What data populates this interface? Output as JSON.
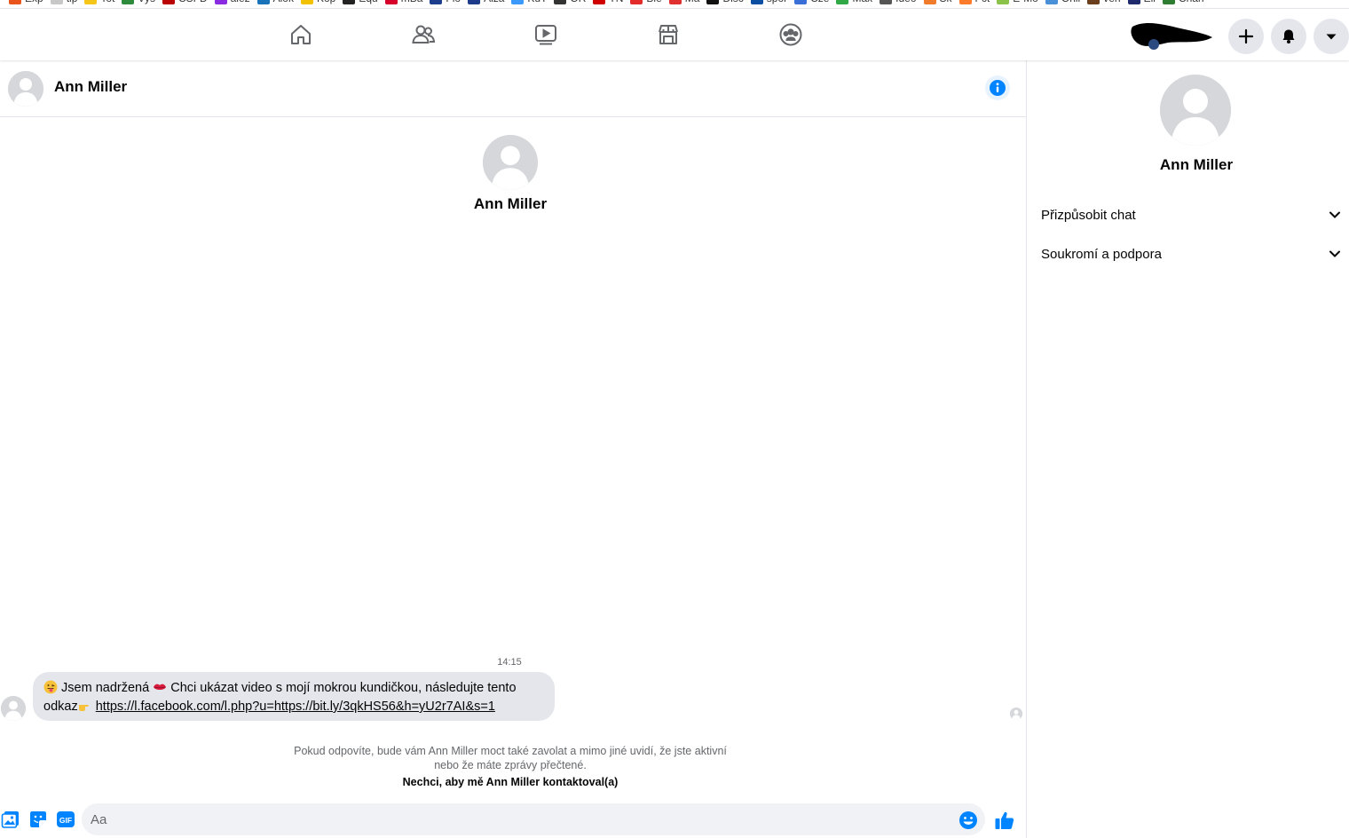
{
  "bookmarks": [
    {
      "label": "Exp",
      "color": "#e8541c"
    },
    {
      "label": "tip",
      "color": "#c8c8c8"
    },
    {
      "label": "Tot",
      "color": "#f5c518"
    },
    {
      "label": "Vys",
      "color": "#2e8b3e"
    },
    {
      "label": "ČSFD",
      "color": "#ba0305"
    },
    {
      "label": "alez",
      "color": "#8a2be2"
    },
    {
      "label": "Alok",
      "color": "#1a73b8"
    },
    {
      "label": "Kop",
      "color": "#f2c100"
    },
    {
      "label": "Equ",
      "color": "#222222"
    },
    {
      "label": "mBa",
      "color": "#d6002a"
    },
    {
      "label": "Flo",
      "color": "#1d3e8c"
    },
    {
      "label": "Alza",
      "color": "#1e3b8a"
    },
    {
      "label": "KuT",
      "color": "#3b99fc"
    },
    {
      "label": "OR",
      "color": "#333333"
    },
    {
      "label": "TN",
      "color": "#d00000"
    },
    {
      "label": "Ble",
      "color": "#e32b2b"
    },
    {
      "label": "Ma",
      "color": "#e03030"
    },
    {
      "label": "Disc",
      "color": "#111111"
    },
    {
      "label": "spor",
      "color": "#0b4ea2"
    },
    {
      "label": "Cze",
      "color": "#3a6fd8"
    },
    {
      "label": "Max",
      "color": "#2fa845"
    },
    {
      "label": "Ideo",
      "color": "#555555"
    },
    {
      "label": "Sk",
      "color": "#f07b2b"
    },
    {
      "label": "Fct",
      "color": "#ff7a2b"
    },
    {
      "label": "E-Mo",
      "color": "#8bc34a"
    },
    {
      "label": "Onli",
      "color": "#4a90d9"
    },
    {
      "label": "ven",
      "color": "#6b3e1e"
    },
    {
      "label": "Eli",
      "color": "#1e2a6b"
    },
    {
      "label": "Chan",
      "color": "#2e7d32"
    }
  ],
  "nav": {
    "tabs": [
      {
        "name": "nav-home",
        "icon": "home-icon"
      },
      {
        "name": "nav-friends",
        "icon": "friends-icon"
      },
      {
        "name": "nav-watch",
        "icon": "video-icon"
      },
      {
        "name": "nav-marketplace",
        "icon": "marketplace-icon"
      },
      {
        "name": "nav-groups",
        "icon": "groups-icon"
      }
    ],
    "actions": [
      {
        "name": "create-button",
        "icon": "plus-icon"
      },
      {
        "name": "notifications-button",
        "icon": "bell-icon"
      },
      {
        "name": "account-menu-button",
        "icon": "caret-down-icon"
      }
    ],
    "inactive_icon_color": "#65676b"
  },
  "chat": {
    "contact_name": "Ann Miller",
    "timestamp": "14:15",
    "message": {
      "prefix": " Jsem nadržená ",
      "middle": " Chci ukázat video s mojí mokrou kundičkou, následujte tento odkaz",
      "link": "https://l.facebook.com/l.php?u=https://bit.ly/3qkHS56&h=yU2r7AI&s=1",
      "emojis": [
        "tongue-face-emoji",
        "kiss-lips-emoji",
        "pointing-finger-emoji"
      ]
    },
    "notice": "Pokud odpovíte, bude vám Ann Miller moct také zavolat a mimo jiné uvidí, že jste aktivní nebo že máte zprávy přečtené.",
    "block_link": "Nechci, aby mě Ann Miller kontaktoval(a)"
  },
  "composer": {
    "placeholder": "Aa",
    "gif_label": "GIF",
    "icons": [
      "photo-icon",
      "sticker-icon",
      "gif-icon",
      "emoji-icon",
      "thumbs-up-icon"
    ]
  },
  "right_panel": {
    "name": "Ann Miller",
    "sections": [
      {
        "label": "Přizpůsobit chat"
      },
      {
        "label": "Soukromí a podpora"
      }
    ]
  },
  "colors": {
    "accent": "#0084ff",
    "bubble": "#e4e6eb",
    "input_bg": "#f0f2f5",
    "secondary_text": "#65676b"
  }
}
